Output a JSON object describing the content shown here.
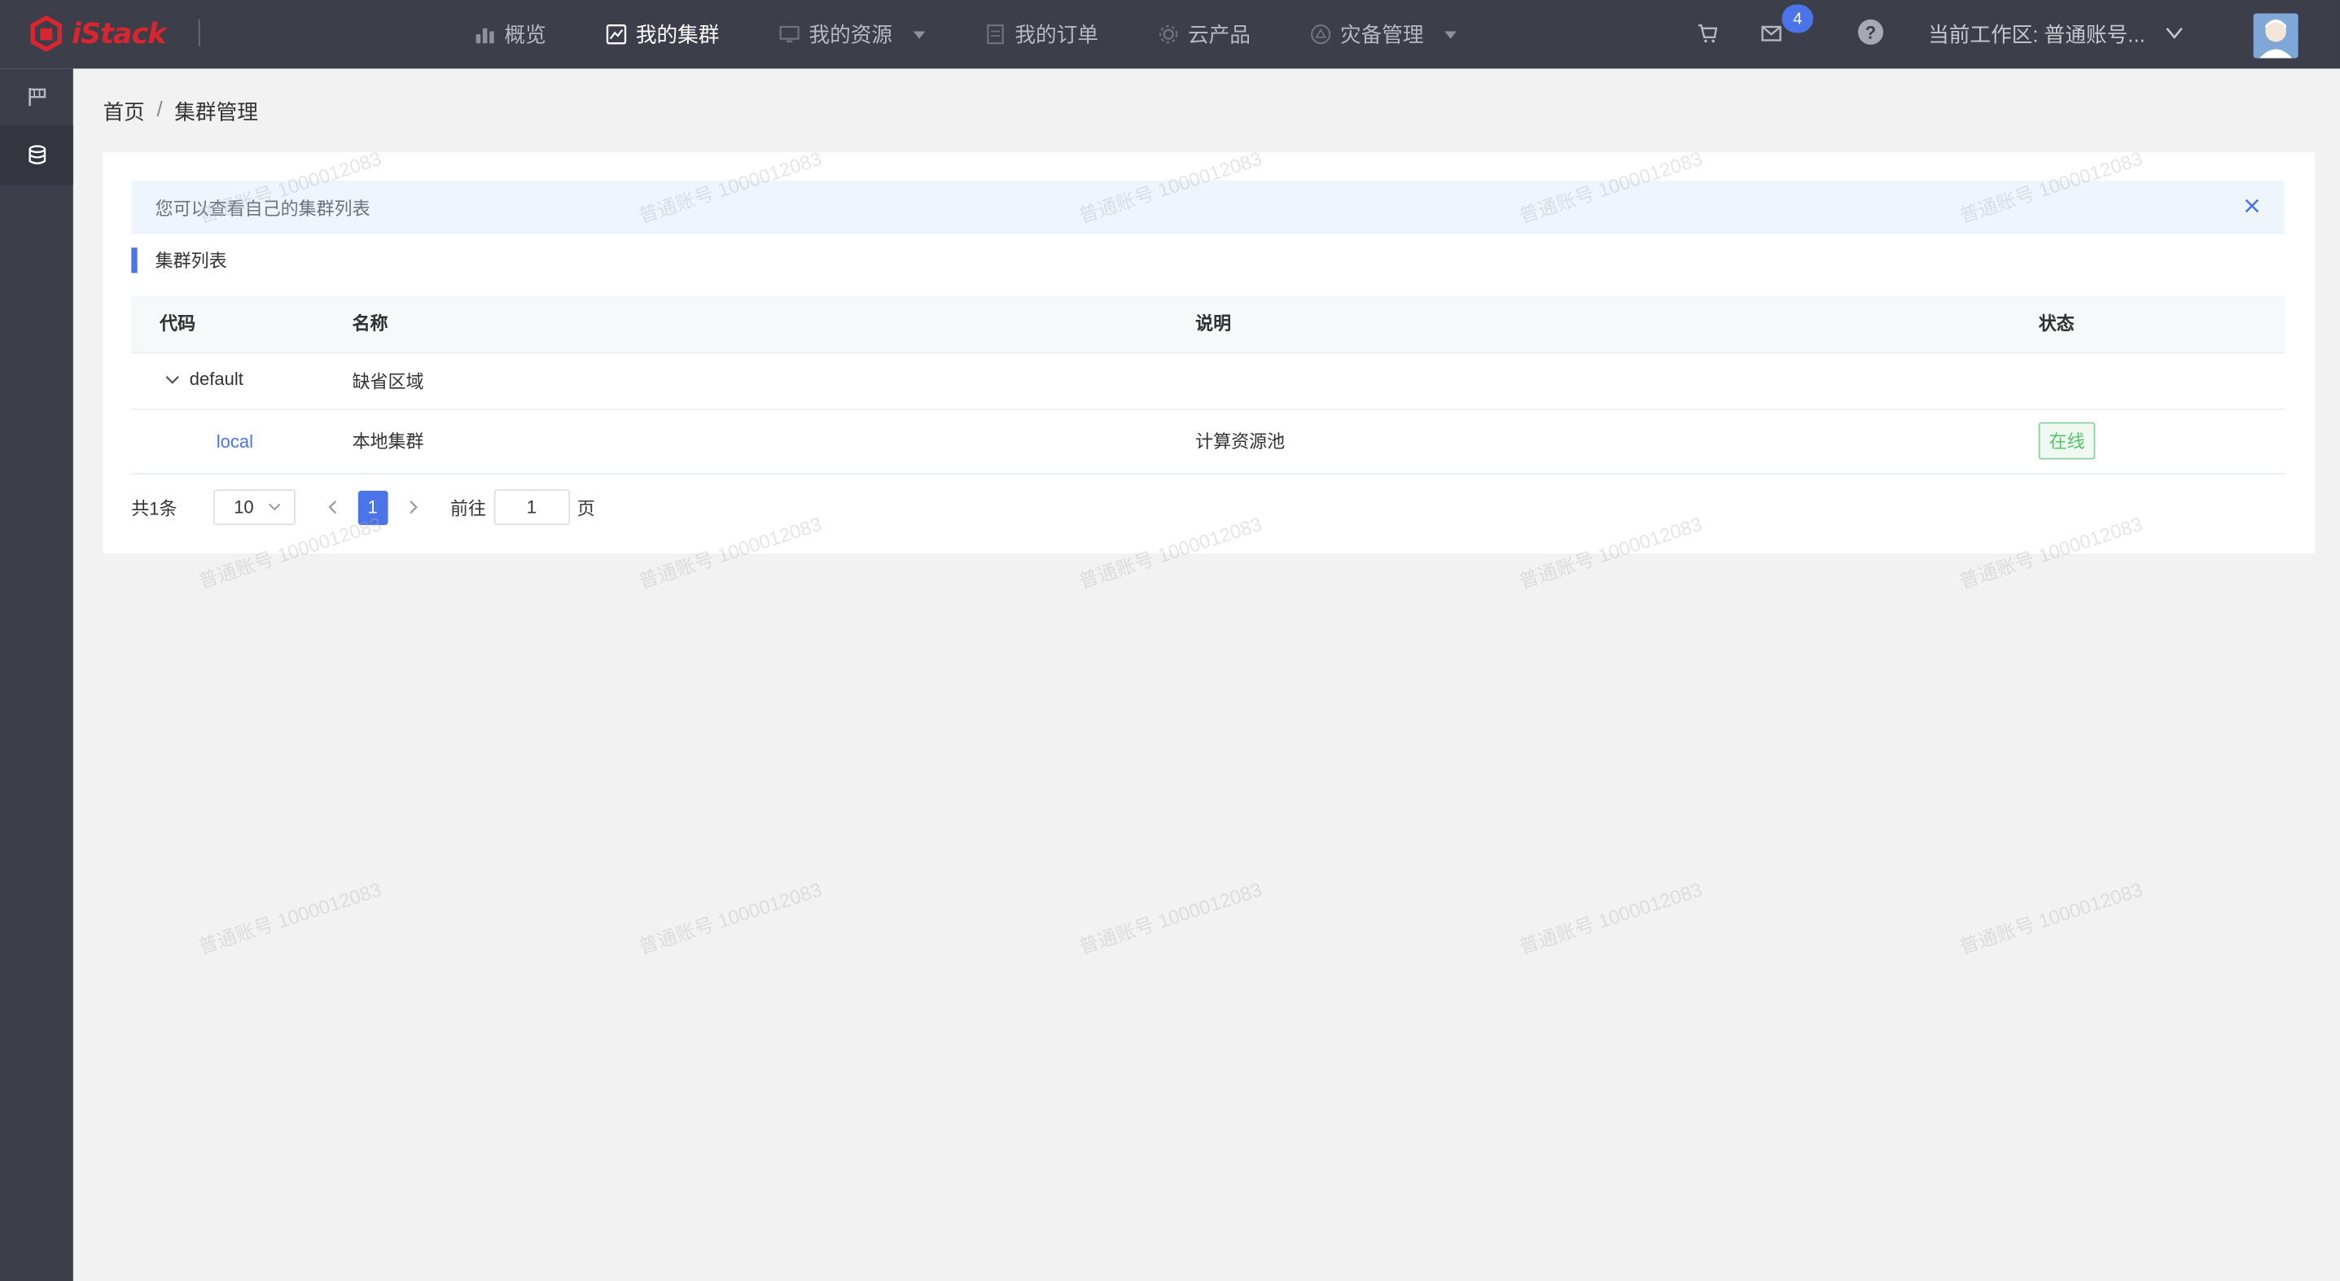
{
  "header": {
    "logo_text": "iStack",
    "nav": [
      {
        "label": "概览",
        "icon": "bar-chart-icon",
        "active": false,
        "dropdown": false
      },
      {
        "label": "我的集群",
        "icon": "cluster-icon",
        "active": true,
        "dropdown": false
      },
      {
        "label": "我的资源",
        "icon": "monitor-icon",
        "active": false,
        "dropdown": true
      },
      {
        "label": "我的订单",
        "icon": "order-icon",
        "active": false,
        "dropdown": false
      },
      {
        "label": "云产品",
        "icon": "gear-icon",
        "active": false,
        "dropdown": false
      },
      {
        "label": "灾备管理",
        "icon": "shield-icon",
        "active": false,
        "dropdown": true
      }
    ],
    "message_count": "4",
    "help_label": "?",
    "workspace_label": "当前工作区: 普通账号..."
  },
  "breadcrumb": {
    "home": "首页",
    "separator": "/",
    "current": "集群管理"
  },
  "alert": {
    "text": "您可以查看自己的集群列表"
  },
  "section": {
    "title": "集群列表"
  },
  "table": {
    "columns": [
      "代码",
      "名称",
      "说明",
      "状态"
    ],
    "group": {
      "code": "default",
      "name": "缺省区域",
      "desc": "",
      "status": ""
    },
    "rows": [
      {
        "code": "local",
        "name": "本地集群",
        "desc": "计算资源池",
        "status": "在线"
      }
    ]
  },
  "pager": {
    "total": "共1条",
    "page_size": "10",
    "current_page": "1",
    "goto_label": "前往",
    "goto_value": "1",
    "page_unit": "页"
  },
  "watermark": "普通账号 1000012083",
  "colors": {
    "topbar": "#3c3f4a",
    "accent": "#4a74e8",
    "logo": "#d9252f",
    "status_online": "#52c26b"
  }
}
